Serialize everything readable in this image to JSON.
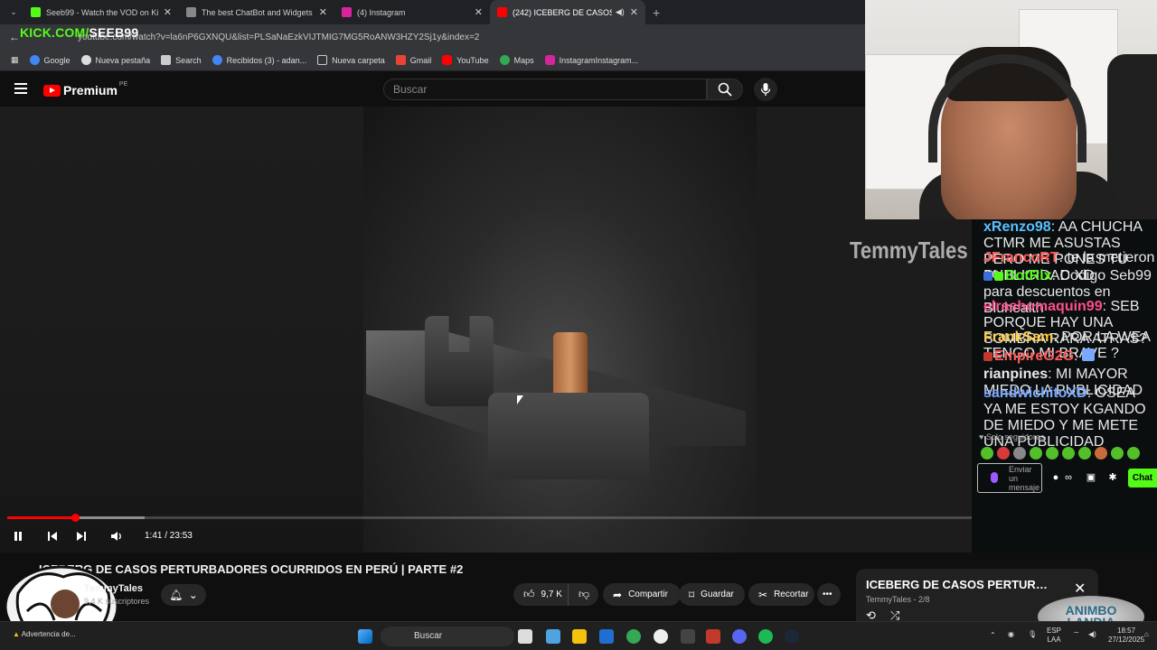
{
  "browser": {
    "tabs": [
      {
        "title": "Seeb99 - Watch the VOD on Kick",
        "color": "#53fc18",
        "active": false
      },
      {
        "title": "The best ChatBot and Widgets",
        "color": "#888888",
        "active": false
      },
      {
        "title": "(4) Instagram",
        "color": "#d6249f",
        "active": false
      },
      {
        "title": "(242) ICEBERG DE CASOS PERTURBADORES",
        "color": "#ff0000",
        "active": true
      }
    ],
    "url": "youtube.com/watch?v=la6nP6GXNQU&list=PLSaNaEzkVIJTMIG7MG5RoANW3HZY2Sj1y&index=2",
    "kick_overlay": "KICK.COM/",
    "kick_overlay_user": "SEEB99",
    "bookmarks": [
      "Google",
      "Nueva pestaña",
      "Search",
      "Recibidos (3) - adan...",
      "Nueva carpeta",
      "Gmail",
      "YouTube",
      "Maps",
      "InstagramInstagram..."
    ]
  },
  "youtube": {
    "logo_text": "Premium",
    "country": "PE",
    "search_placeholder": "Buscar",
    "watermark": "TemmyTales",
    "time": "1:41 / 23:53",
    "progress": {
      "played_fraction": 0.0707,
      "buffered_fraction": 0.1424
    },
    "video_title": "ICEBERG DE CASOS PERTURBADORES OCURRIDOS EN PERÚ | PARTE #2",
    "channel": "TemmyTales",
    "subscribers": "9,4 K suscriptores",
    "actions": {
      "likes": "9,7 K",
      "share": "Compartir",
      "save": "Guardar",
      "clip": "Recortar"
    },
    "playlist": {
      "title": "ICEBERG DE CASOS PERTURBADO...",
      "sub": "TemmyTales - 2/8"
    }
  },
  "chat": {
    "messages": [
      {
        "user": "xRenzo98",
        "color": "#5bc0ff",
        "text": "AA CHUCHA CTMR ME ASUSTAS PERO ME PONES TU PUBLICIDAD XD"
      },
      {
        "user": "JFrancoRT",
        "color": "#ff5a5a",
        "text": "te la metieron oe"
      },
      {
        "user": "BotRix",
        "color": "#53fc18",
        "text": "Codigo Seb99 para descuentos en Bluhealth"
      },
      {
        "user": "elrashomaquin99",
        "color": "#ff4d8d",
        "text": "SEB PORQUE HAY UNA SOMBRA RARA ATRAS?"
      },
      {
        "user": "FrankSam",
        "color": "#ffcf4d",
        "text": "POR LA WEA TENGO MI BRAVE ?"
      },
      {
        "user": "EmpireG2G",
        "color": "#ff5a5a",
        "text": ""
      },
      {
        "user": "rianpines",
        "color": "#e8e8e8",
        "text": "MI MAYOR MIEDO LA PUBLICIDAD"
      },
      {
        "user": "sandwichitoXD",
        "color": "#7aa8ff",
        "text": "OSEA YA ME ESTOY KGANDO DE MIEDO Y ME METE UNA PUBLICIDAD"
      }
    ],
    "followers_only": "Solo seguidores",
    "input_placeholder": "Enviar un mensaje",
    "send_label": "Chat"
  },
  "overlay_logo": {
    "line1": "ANIMBO",
    "line2": "LANDIA"
  },
  "taskbar": {
    "search_placeholder": "Buscar",
    "lang": "ESP",
    "lang2": "LAA",
    "time": "18:57",
    "date": "27/12/2025",
    "weather": "Advertencia de..."
  }
}
